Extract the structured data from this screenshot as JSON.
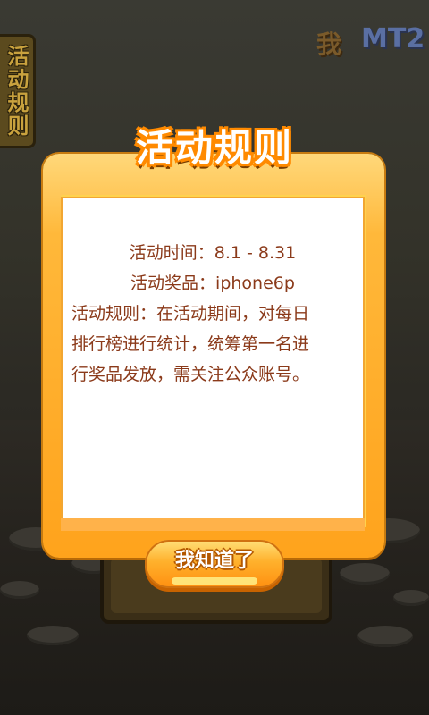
{
  "side_tab": {
    "label": "活动规则"
  },
  "logo": {
    "part1": "我",
    "part2": "MT2"
  },
  "dialog": {
    "title": "活动规则",
    "lines": [
      "活动时间：8.1 - 8.31",
      "活动奖品：iphone6p",
      "活动规则：在活动期间，对每日",
      "排行榜进行统计，统筹第一名进",
      "行奖品发放，需关注公众账号。"
    ],
    "button_label": "我知道了"
  },
  "colors": {
    "panel_orange": "#ffa31c",
    "text_brown": "#8b3a1a",
    "title_white": "#ffffff"
  }
}
